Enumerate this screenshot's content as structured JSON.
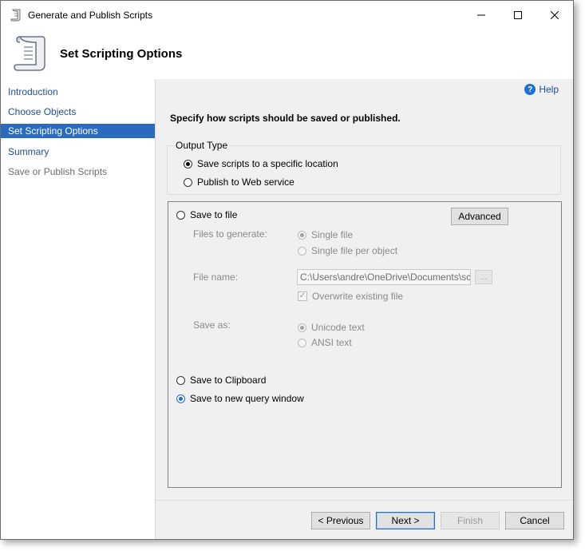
{
  "window": {
    "title": "Generate and Publish Scripts",
    "minimize_icon": "minimize-icon",
    "maximize_icon": "maximize-icon",
    "close_icon": "close-icon"
  },
  "header": {
    "title": "Set Scripting Options",
    "icon": "scroll-icon"
  },
  "nav": {
    "items": [
      {
        "label": "Introduction",
        "state": "link"
      },
      {
        "label": "Choose Objects",
        "state": "link"
      },
      {
        "label": "Set Scripting Options",
        "state": "active"
      },
      {
        "label": "Summary",
        "state": "link"
      },
      {
        "label": "Save or Publish Scripts",
        "state": "disabled"
      }
    ]
  },
  "main": {
    "help_label": "Help",
    "instruction": "Specify how scripts should be saved or published.",
    "output_type": {
      "legend": "Output Type",
      "options": [
        {
          "label": "Save scripts to a specific location",
          "selected": true
        },
        {
          "label": "Publish to Web service",
          "selected": false
        }
      ]
    },
    "save_to_file": {
      "label": "Save to file",
      "advanced_label": "Advanced",
      "files_to_generate_label": "Files to generate:",
      "files_options": [
        "Single file",
        "Single file per object"
      ],
      "file_name_label": "File name:",
      "file_name_value": "C:\\Users\\andre\\OneDrive\\Documents\\script",
      "browse_label": "...",
      "overwrite_label": "Overwrite existing file",
      "save_as_label": "Save as:",
      "save_as_options": [
        "Unicode text",
        "ANSI text"
      ]
    },
    "clipboard_label": "Save to Clipboard",
    "query_window_label": "Save to new query window"
  },
  "footer": {
    "previous_label": "< Previous",
    "next_label": "Next >",
    "finish_label": "Finish",
    "cancel_label": "Cancel"
  },
  "colors": {
    "accent": "#2b6bbf",
    "link": "#1e4e9a",
    "panel_bg": "#f0f0f0"
  }
}
